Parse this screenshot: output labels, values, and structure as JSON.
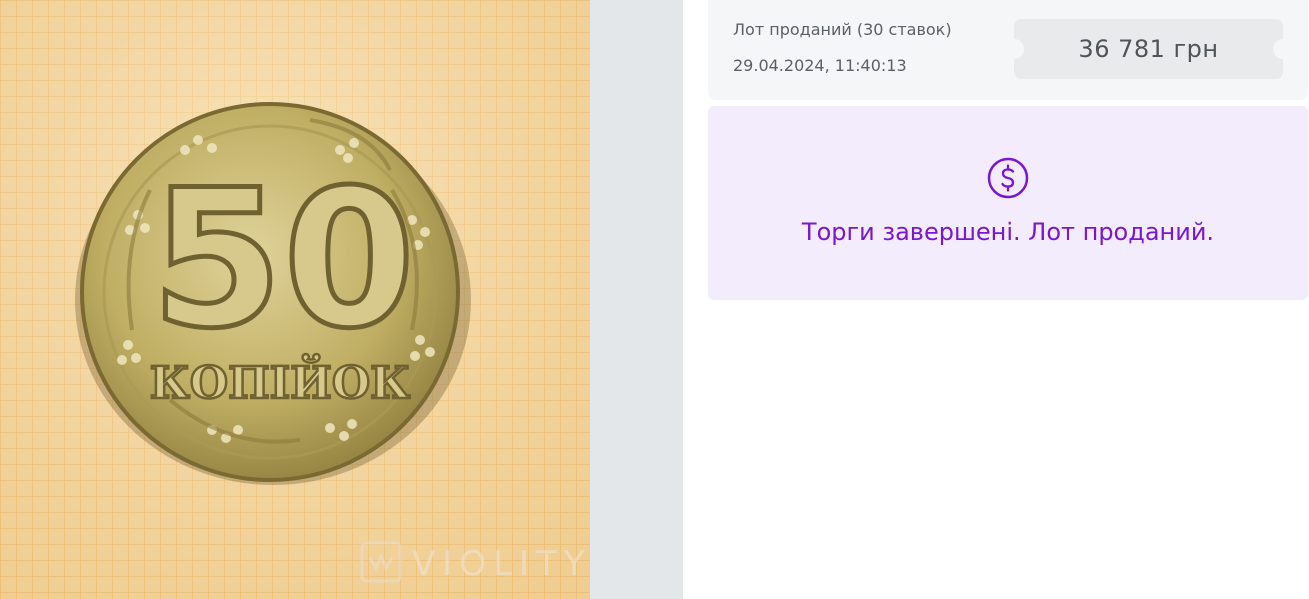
{
  "photo": {
    "coin_denomination_text": "50",
    "coin_unit_text": "КОПІЙОК",
    "watermark_text": "VIOLITY"
  },
  "lot": {
    "status_text": "Лот проданий (30 ставок)",
    "date_text": "29.04.2024, 11:40:13",
    "price_text": "36 781 грн"
  },
  "notice": {
    "icon": "dollar-circle-icon",
    "message": "Торги завершені. Лот проданий."
  },
  "colors": {
    "accent": "#7a16d8",
    "notice_bg": "#f3ecfc",
    "ticket_bg": "#e8eaec",
    "photo_bg": "#f3d49a",
    "coin": "#c9b66a"
  }
}
